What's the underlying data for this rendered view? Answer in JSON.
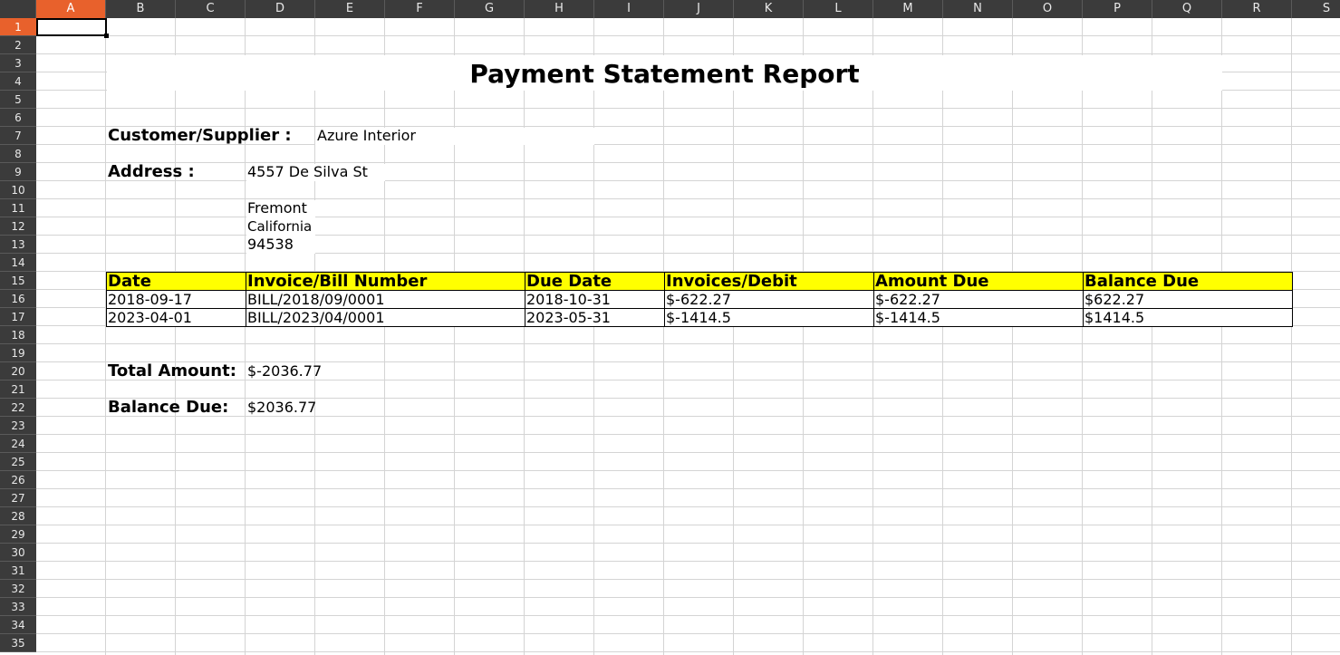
{
  "columns": [
    "A",
    "B",
    "C",
    "D",
    "E",
    "F",
    "G",
    "H",
    "I",
    "J",
    "K",
    "L",
    "M",
    "N",
    "O",
    "P",
    "Q",
    "R",
    "S"
  ],
  "rows": [
    "1",
    "2",
    "3",
    "4",
    "5",
    "6",
    "7",
    "8",
    "9",
    "10",
    "11",
    "12",
    "13",
    "14",
    "15",
    "16",
    "17",
    "18",
    "19",
    "20",
    "21",
    "22",
    "23",
    "24",
    "25",
    "26",
    "27",
    "28",
    "29",
    "30",
    "31",
    "32",
    "33",
    "34",
    "35"
  ],
  "active_cell": "A1",
  "report": {
    "title": "Payment Statement Report",
    "customer_label": "Customer/Supplier :",
    "customer_value": "Azure Interior",
    "address_label": "Address :",
    "address_line1": "4557 De Silva St",
    "address_city": "Fremont",
    "address_state": "California",
    "address_zip": "94538"
  },
  "table": {
    "headers": [
      "Date",
      "Invoice/Bill Number",
      "Due Date",
      "Invoices/Debit",
      "Amount Due",
      "Balance Due"
    ],
    "rows": [
      [
        "2018-09-17",
        "BILL/2018/09/0001",
        "2018-10-31",
        "$-622.27",
        "$-622.27",
        "$622.27"
      ],
      [
        "2023-04-01",
        "BILL/2023/04/0001",
        "2023-05-31",
        "$-1414.5",
        "$-1414.5",
        "$1414.5"
      ]
    ]
  },
  "totals": {
    "total_amount_label": "Total Amount:",
    "total_amount_value": "$-2036.77",
    "balance_due_label": "Balance Due:",
    "balance_due_value": "$2036.77"
  },
  "colors": {
    "header_bg": "#3b3b3b",
    "active_header": "#e8612c",
    "table_header_fill": "#ffff00"
  }
}
